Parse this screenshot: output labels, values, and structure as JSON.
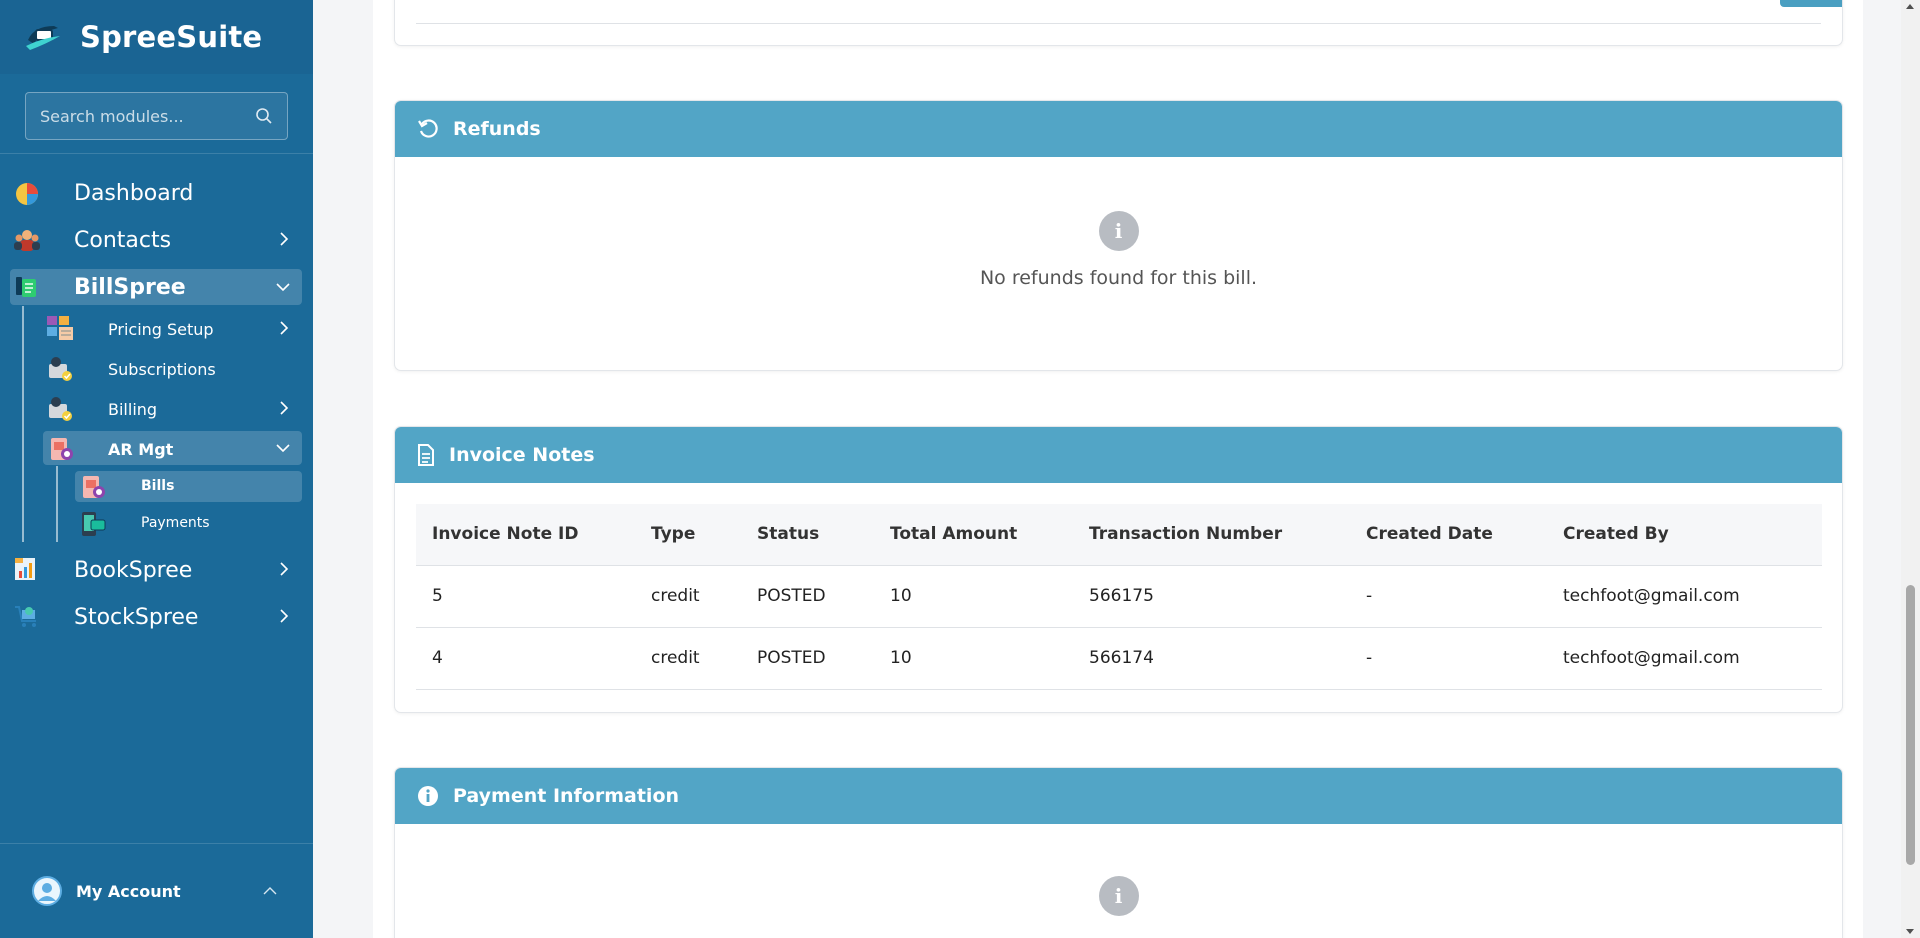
{
  "app": {
    "name": "SpreeSuite"
  },
  "search": {
    "placeholder": "Search modules..."
  },
  "nav": {
    "dashboard": "Dashboard",
    "contacts": "Contacts",
    "billspree": "BillSpree",
    "pricing_setup": "Pricing Setup",
    "subscriptions": "Subscriptions",
    "billing": "Billing",
    "ar_mgt": "AR Mgt",
    "bills": "Bills",
    "payments": "Payments",
    "bookspree": "BookSpree",
    "stockspree": "StockSpree"
  },
  "account": {
    "label": "My Account"
  },
  "refunds": {
    "title": "Refunds",
    "empty": "No refunds found for this bill."
  },
  "invoice_notes": {
    "title": "Invoice Notes",
    "columns": [
      "Invoice Note ID",
      "Type",
      "Status",
      "Total Amount",
      "Transaction Number",
      "Created Date",
      "Created By"
    ],
    "rows": [
      [
        "5",
        "credit",
        "POSTED",
        "10",
        "566175",
        "-",
        "techfoot@gmail.com"
      ],
      [
        "4",
        "credit",
        "POSTED",
        "10",
        "566174",
        "-",
        "techfoot@gmail.com"
      ]
    ]
  },
  "payment_info": {
    "title": "Payment Information"
  },
  "colors": {
    "sidebar": "#1b6a99",
    "card_header": "#52a5c6"
  }
}
